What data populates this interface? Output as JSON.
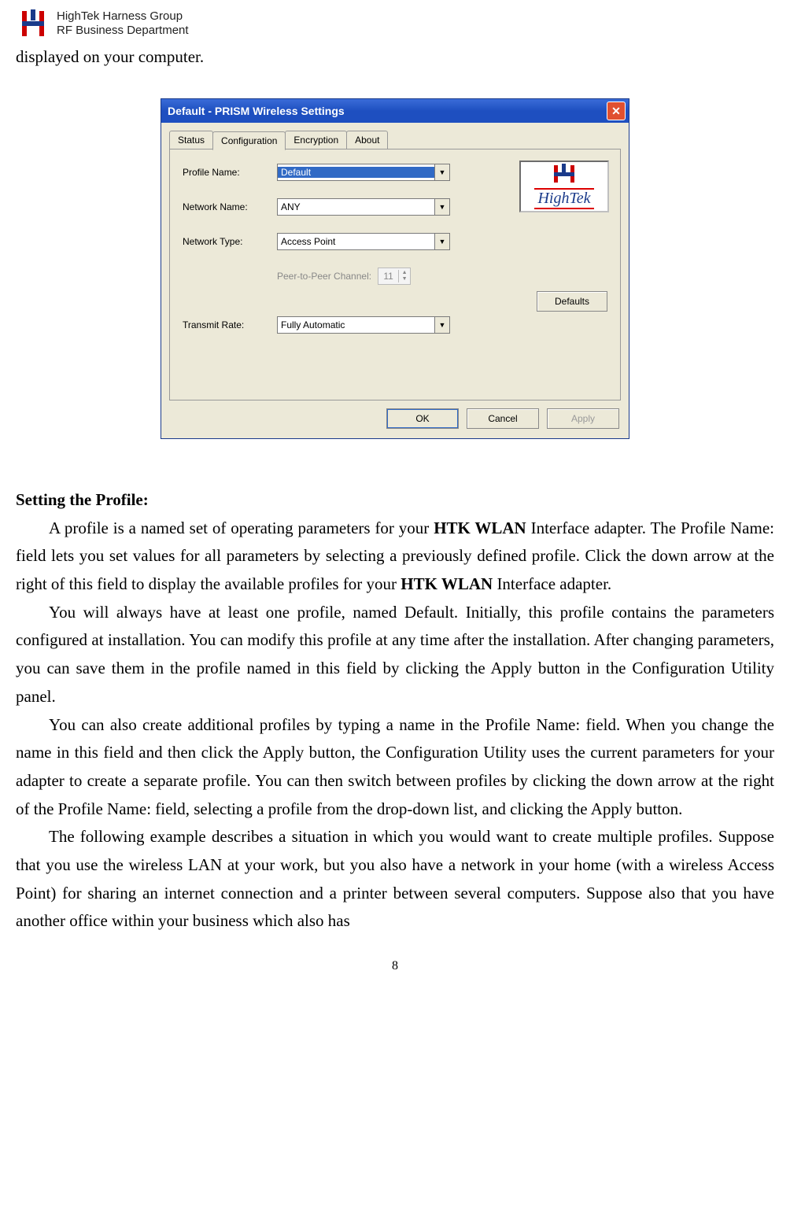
{
  "header": {
    "line1": "HighTek Harness Group",
    "line2": "RF Business Department"
  },
  "intro": "displayed on your computer.",
  "window": {
    "title": "Default - PRISM Wireless Settings",
    "close_glyph": "✕",
    "tabs": [
      "Status",
      "Configuration",
      "Encryption",
      "About"
    ],
    "active_tab_index": 1,
    "fields": {
      "profile_name": {
        "label": "Profile Name:",
        "value": "Default"
      },
      "network_name": {
        "label": "Network Name:",
        "value": "ANY"
      },
      "network_type": {
        "label": "Network Type:",
        "value": "Access Point"
      },
      "p2p_channel": {
        "label": "Peer-to-Peer Channel:",
        "value": "11"
      },
      "transmit_rate": {
        "label": "Transmit Rate:",
        "value": "Fully Automatic"
      }
    },
    "brand_text": "HighTek",
    "defaults_btn": "Defaults",
    "ok_btn": "OK",
    "cancel_btn": "Cancel",
    "apply_btn": "Apply"
  },
  "section": {
    "heading": "Setting the Profile:",
    "p1a": "A profile is a named set of operating parameters for your ",
    "p1b": "HTK WLAN",
    "p1c": " Interface adapter. The Profile Name: field lets you set values for all parameters by selecting a previously defined profile. Click the down arrow at the right of this field to display the available profiles for your  ",
    "p1d": "HTK WLAN",
    "p1e": " Interface adapter.",
    "p2": "You will always have at least one profile, named Default. Initially, this profile contains the parameters configured at installation. You can modify this profile at any time after the installation. After changing parameters, you can save them in the profile named in this field by clicking the Apply button in the Configuration Utility panel.",
    "p3": "You can also create additional profiles by typing a name in the Profile Name: field. When you change the name in this field and then click the Apply button, the Configuration Utility uses the current parameters for your adapter to create a separate profile. You can then switch between profiles by clicking the down arrow at the right of the Profile Name: field, selecting a profile from the drop-down list, and clicking the Apply button.",
    "p4": "The following example describes a situation in which you would want to create multiple profiles. Suppose that you use the wireless LAN at your work, but you also have a network in your home (with a wireless Access Point) for sharing an internet connection and a printer between several computers. Suppose also that you have another office within your business which also has"
  },
  "page_number": "8"
}
